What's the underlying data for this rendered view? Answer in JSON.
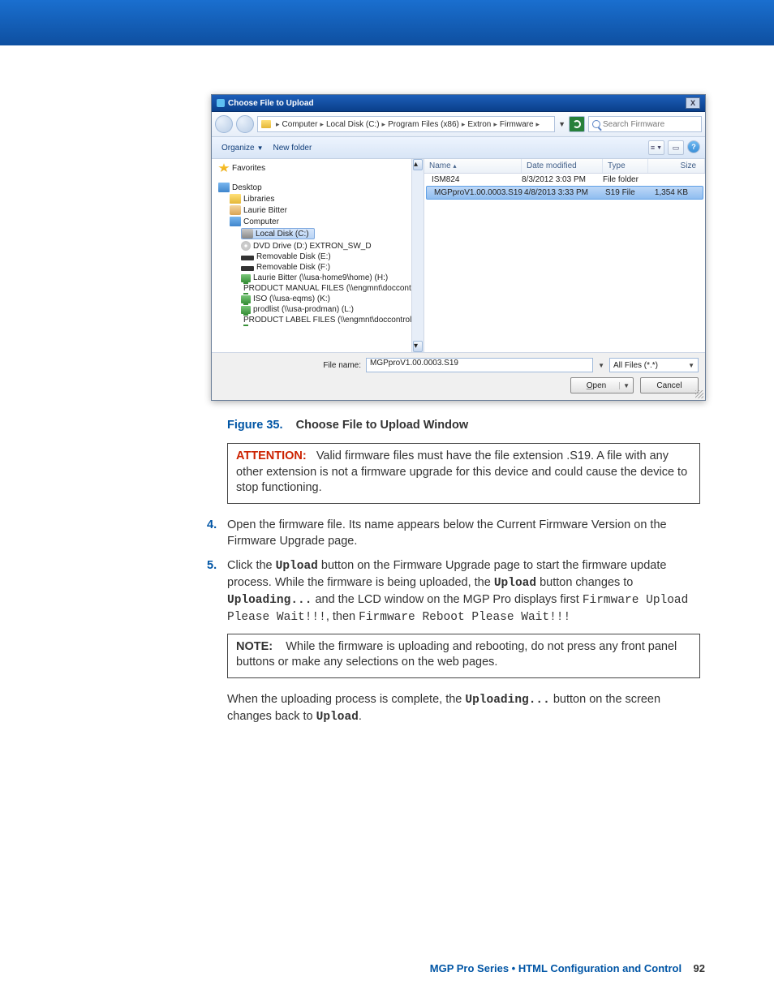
{
  "dialog": {
    "title": "Choose File to Upload",
    "close": "X",
    "path": {
      "p1": "Computer",
      "p2": "Local Disk (C:)",
      "p3": "Program Files (x86)",
      "p4": "Extron",
      "p5": "Firmware"
    },
    "search_placeholder": "Search Firmware",
    "toolbar": {
      "organize": "Organize",
      "newfolder": "New folder"
    },
    "cols": {
      "name": "Name",
      "date": "Date modified",
      "type": "Type",
      "size": "Size"
    },
    "tree": {
      "favorites": "Favorites",
      "desktop": "Desktop",
      "libraries": "Libraries",
      "user": "Laurie Bitter",
      "computer": "Computer",
      "localc": "Local Disk (C:)",
      "dvd": "DVD Drive (D:) EXTRON_SW_D",
      "reme": "Removable Disk (E:)",
      "remf": "Removable Disk (F:)",
      "neth": "Laurie Bitter (\\\\usa-home9\\home) (H:)",
      "netj": "PRODUCT MANUAL FILES (\\\\engmnt\\doccontrol$) (J:)",
      "netk": "ISO (\\\\usa-eqms) (K:)",
      "netl": "prodlist (\\\\usa-prodman) (L:)",
      "netn": "PRODUCT LABEL FILES (\\\\engmnt\\doccontrol$) (N:)"
    },
    "rows": [
      {
        "name": "ISM824",
        "date": "8/3/2012 3:03 PM",
        "type": "File folder",
        "size": "",
        "sel": false,
        "iconClass": "fld"
      },
      {
        "name": "MGPproV1.00.0003.S19",
        "date": "4/8/2013 3:33 PM",
        "type": "S19 File",
        "size": "1,354 KB",
        "sel": true,
        "iconClass": "disk"
      }
    ],
    "filename_label": "File name:",
    "filename_value": "MGPproV1.00.0003.S19",
    "filter": "All Files (*.*)",
    "open": "Open",
    "cancel": "Cancel"
  },
  "caption": {
    "fig": "Figure 35.",
    "text": "Choose File to Upload Window"
  },
  "attention": {
    "tag": "ATTENTION:",
    "text": "Valid firmware files must have the file extension .S19. A file with any other extension is not a firmware upgrade for this device and could cause the device to stop functioning."
  },
  "step4": {
    "n": "4.",
    "text": "Open the firmware file. Its name appears below the Current Firmware Version on the Firmware Upgrade page."
  },
  "step5": {
    "n": "5.",
    "a": "Click the ",
    "b": "Upload",
    "c": " button on the Firmware Upgrade page to start the firmware update process. While the firmware is being uploaded, the ",
    "d": "Upload",
    "e": " button changes to ",
    "f": "Uploading...",
    "g": " and the LCD window on the MGP Pro displays first ",
    "h": "Firmware Upload Please Wait!!!",
    "i": ", then ",
    "j": "Firmware Reboot Please Wait!!!"
  },
  "note": {
    "tag": "NOTE:",
    "text": "While the firmware is uploading and rebooting, do not press any front panel buttons or make any selections on the web pages."
  },
  "after": {
    "a": "When the uploading process is complete, the ",
    "b": "Uploading...",
    "c": " button on the screen changes back to ",
    "d": "Upload",
    "e": "."
  },
  "footer": {
    "title": "MGP Pro Series • HTML Configuration and Control",
    "page": "92"
  }
}
